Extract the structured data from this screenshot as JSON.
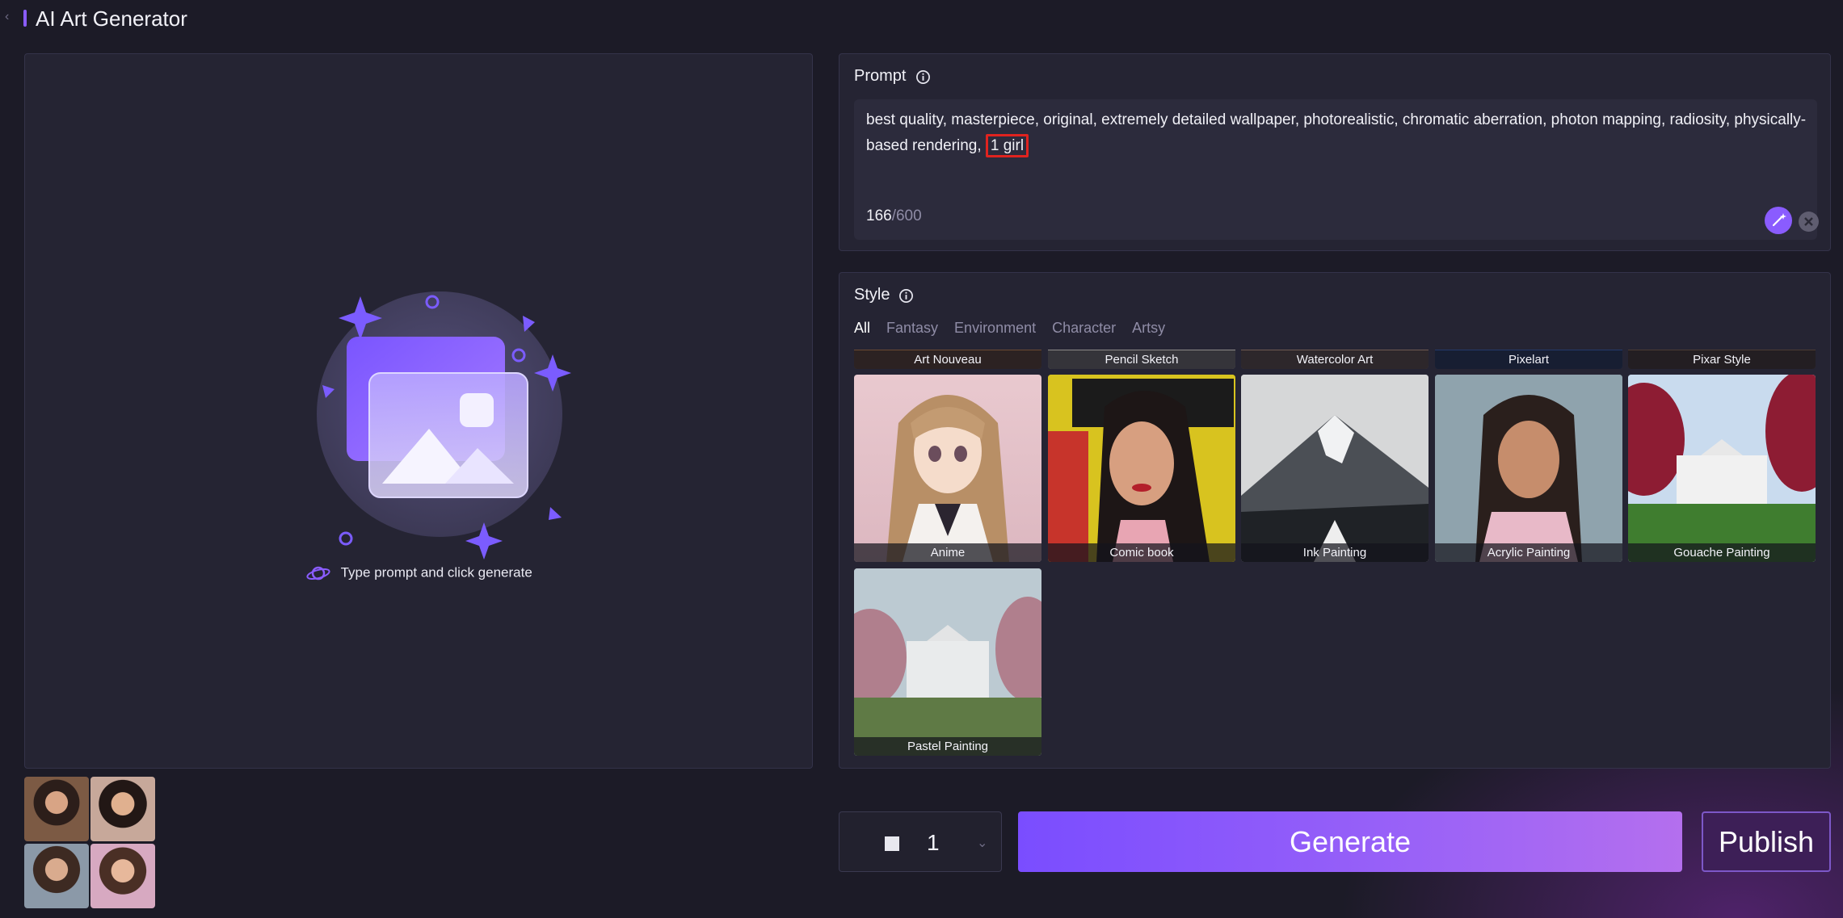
{
  "app": {
    "title": "AI Art Generator"
  },
  "canvas": {
    "hint": "Type prompt and click generate"
  },
  "prompt": {
    "heading": "Prompt",
    "text_main": "best quality, masterpiece, original, extremely detailed wallpaper, photorealistic, chromatic aberration, photon mapping, radiosity, physically-based rendering, ",
    "text_highlight": "1 girl",
    "char_used": "166",
    "char_max": "/600"
  },
  "style": {
    "heading": "Style",
    "tabs": [
      {
        "label": "All",
        "active": true
      },
      {
        "label": "Fantasy",
        "active": false
      },
      {
        "label": "Environment",
        "active": false
      },
      {
        "label": "Character",
        "active": false
      },
      {
        "label": "Artsy",
        "active": false
      }
    ],
    "strip_items": [
      "Art Nouveau",
      "Pencil Sketch",
      "Watercolor Art",
      "Pixelart",
      "Pixar Style"
    ],
    "items": [
      "Anime",
      "Comic book",
      "Ink Painting",
      "Acrylic Painting",
      "Gouache Painting",
      "Pastel Painting"
    ]
  },
  "controls": {
    "quantity": "1",
    "generate_label": "Generate",
    "publish_label": "Publish"
  },
  "colors": {
    "accent": "#8a5cff",
    "highlight_border": "#e0231f",
    "background": "#1c1b27",
    "panel": "#252433"
  }
}
